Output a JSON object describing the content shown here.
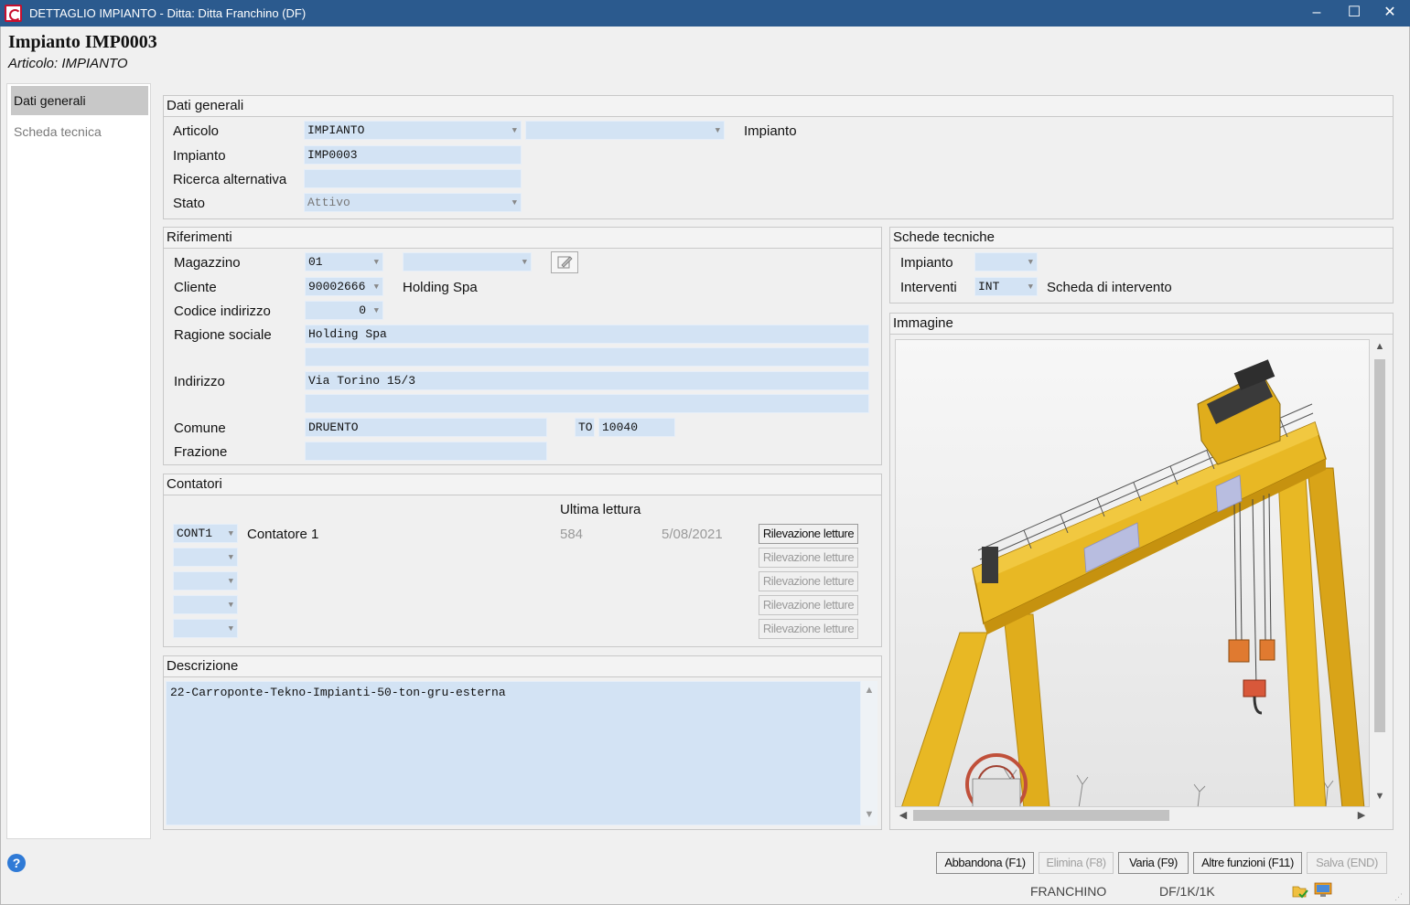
{
  "window": {
    "title": "DETTAGLIO IMPIANTO - Ditta: Ditta Franchino (DF)",
    "minimize": "–",
    "maximize": "☐",
    "close": "✕"
  },
  "header": {
    "title": "Impianto IMP0003",
    "subtitle": "Articolo: IMPIANTO"
  },
  "nav": {
    "items": [
      {
        "label": "Dati generali"
      },
      {
        "label": "Scheda tecnica"
      }
    ]
  },
  "dati_generali": {
    "heading": "Dati generali",
    "articolo_label": "Articolo",
    "articolo_value": "IMPIANTO",
    "articolo_desc": "Impianto",
    "impianto_label": "Impianto",
    "impianto_value": "IMP0003",
    "ricerca_label": "Ricerca alternativa",
    "ricerca_value": "",
    "stato_label": "Stato",
    "stato_value": "Attivo"
  },
  "riferimenti": {
    "heading": "Riferimenti",
    "magazzino_label": "Magazzino",
    "magazzino_value": "01",
    "cliente_label": "Cliente",
    "cliente_value": "90002666",
    "cliente_desc": "Holding Spa",
    "codice_indirizzo_label": "Codice indirizzo",
    "codice_indirizzo_value": "0",
    "ragione_sociale_label": "Ragione sociale",
    "ragione_sociale_value": "Holding Spa",
    "ragione_sociale_2": "",
    "indirizzo_label": "Indirizzo",
    "indirizzo_value": "Via Torino 15/3",
    "indirizzo_2": "",
    "comune_label": "Comune",
    "comune_value": "DRUENTO",
    "provincia_value": "TO",
    "cap_value": "10040",
    "frazione_label": "Frazione",
    "frazione_value": ""
  },
  "schede_tecniche": {
    "heading": "Schede tecniche",
    "impianto_label": "Impianto",
    "impianto_value": "",
    "interventi_label": "Interventi",
    "interventi_value": "INT",
    "interventi_desc": "Scheda di intervento"
  },
  "immagine": {
    "heading": "Immagine"
  },
  "contatori": {
    "heading": "Contatori",
    "ultima_lettura_label": "Ultima lettura",
    "rows": [
      {
        "code": "CONT1",
        "desc": "Contatore 1",
        "value": "584",
        "date": "5/08/2021",
        "button": "Rilevazione letture"
      },
      {
        "code": "",
        "desc": "",
        "value": "",
        "date": "",
        "button": "Rilevazione letture"
      },
      {
        "code": "",
        "desc": "",
        "value": "",
        "date": "",
        "button": "Rilevazione letture"
      },
      {
        "code": "",
        "desc": "",
        "value": "",
        "date": "",
        "button": "Rilevazione letture"
      },
      {
        "code": "",
        "desc": "",
        "value": "",
        "date": "",
        "button": "Rilevazione letture"
      }
    ]
  },
  "descrizione": {
    "heading": "Descrizione",
    "text": "22-Carroponte-Tekno-Impianti-50-ton-gru-esterna"
  },
  "footer": {
    "help": "?",
    "buttons": {
      "abbandona": "Abbandona (F1)",
      "elimina": "Elimina (F8)",
      "varia": "Varia (F9)",
      "altre": "Altre funzioni (F11)",
      "salva": "Salva (END)"
    },
    "user": "FRANCHINO",
    "session": "DF/1K/1K"
  },
  "colors": {
    "titlebar": "#2b5a8e",
    "field": "#d3e3f4",
    "crane_yellow": "#e8b824"
  },
  "icons": {
    "edit": "edit-icon",
    "help": "help-icon",
    "status1": "folder-check-icon",
    "status2": "monitor-icon"
  }
}
